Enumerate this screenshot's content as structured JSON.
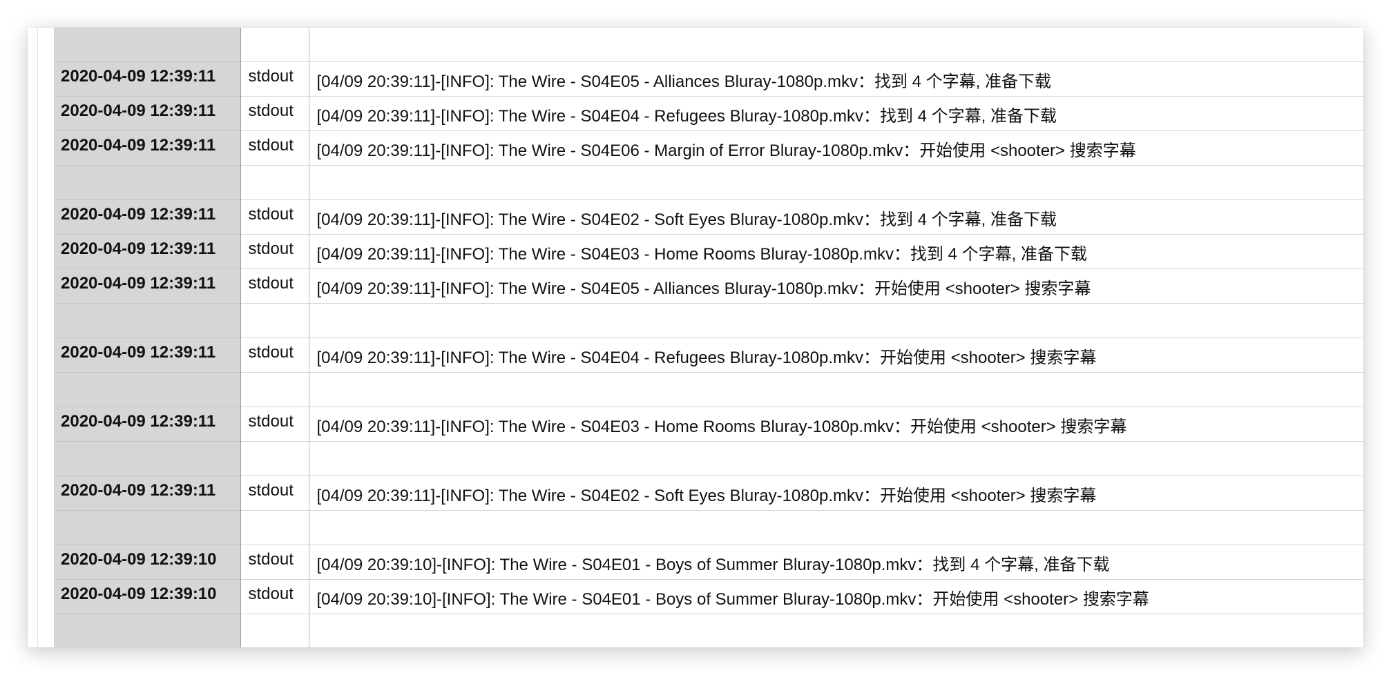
{
  "log": {
    "rows": [
      {
        "timestamp": "",
        "stream": "",
        "message": ""
      },
      {
        "timestamp": "2020-04-09 12:39:11",
        "stream": "stdout",
        "message": "[04/09 20:39:11]-[INFO]: The Wire - S04E05 - Alliances Bluray-1080p.mkv：找到 4 个字幕, 准备下载"
      },
      {
        "timestamp": "2020-04-09 12:39:11",
        "stream": "stdout",
        "message": "[04/09 20:39:11]-[INFO]: The Wire - S04E04 - Refugees Bluray-1080p.mkv：找到 4 个字幕, 准备下载"
      },
      {
        "timestamp": "2020-04-09 12:39:11",
        "stream": "stdout",
        "message": "[04/09 20:39:11]-[INFO]: The Wire - S04E06 - Margin of Error Bluray-1080p.mkv：开始使用 <shooter> 搜索字幕"
      },
      {
        "timestamp": "",
        "stream": "",
        "message": ""
      },
      {
        "timestamp": "2020-04-09 12:39:11",
        "stream": "stdout",
        "message": "[04/09 20:39:11]-[INFO]: The Wire - S04E02 - Soft Eyes Bluray-1080p.mkv：找到 4 个字幕, 准备下载"
      },
      {
        "timestamp": "2020-04-09 12:39:11",
        "stream": "stdout",
        "message": "[04/09 20:39:11]-[INFO]: The Wire - S04E03 - Home Rooms Bluray-1080p.mkv：找到 4 个字幕, 准备下载"
      },
      {
        "timestamp": "2020-04-09 12:39:11",
        "stream": "stdout",
        "message": "[04/09 20:39:11]-[INFO]: The Wire - S04E05 - Alliances Bluray-1080p.mkv：开始使用 <shooter> 搜索字幕"
      },
      {
        "timestamp": "",
        "stream": "",
        "message": ""
      },
      {
        "timestamp": "2020-04-09 12:39:11",
        "stream": "stdout",
        "message": "[04/09 20:39:11]-[INFO]: The Wire - S04E04 - Refugees Bluray-1080p.mkv：开始使用 <shooter> 搜索字幕"
      },
      {
        "timestamp": "",
        "stream": "",
        "message": ""
      },
      {
        "timestamp": "2020-04-09 12:39:11",
        "stream": "stdout",
        "message": "[04/09 20:39:11]-[INFO]: The Wire - S04E03 - Home Rooms Bluray-1080p.mkv：开始使用 <shooter> 搜索字幕"
      },
      {
        "timestamp": "",
        "stream": "",
        "message": ""
      },
      {
        "timestamp": "2020-04-09 12:39:11",
        "stream": "stdout",
        "message": "[04/09 20:39:11]-[INFO]: The Wire - S04E02 - Soft Eyes Bluray-1080p.mkv：开始使用 <shooter> 搜索字幕"
      },
      {
        "timestamp": "",
        "stream": "",
        "message": ""
      },
      {
        "timestamp": "2020-04-09 12:39:10",
        "stream": "stdout",
        "message": "[04/09 20:39:10]-[INFO]: The Wire - S04E01 - Boys of Summer Bluray-1080p.mkv：找到 4 个字幕, 准备下载"
      },
      {
        "timestamp": "2020-04-09 12:39:10",
        "stream": "stdout",
        "message": "[04/09 20:39:10]-[INFO]: The Wire - S04E01 - Boys of Summer Bluray-1080p.mkv：开始使用 <shooter> 搜索字幕"
      },
      {
        "timestamp": "",
        "stream": "",
        "message": ""
      }
    ]
  },
  "colors": {
    "timestamp_column_bg": "#d6d6d6",
    "grid_line": "#d4d4d4",
    "text": "#111111"
  }
}
